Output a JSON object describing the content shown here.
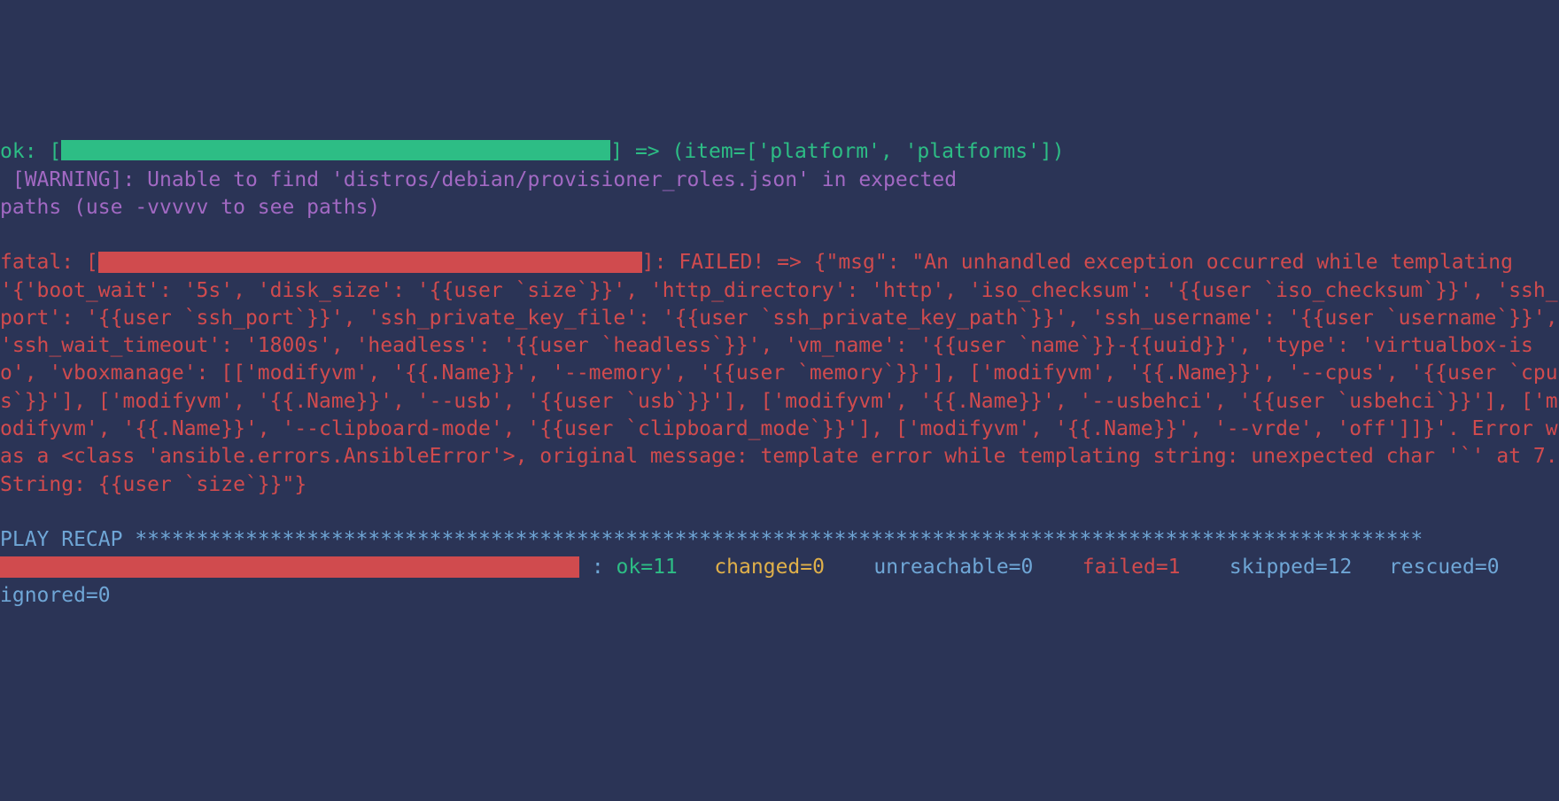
{
  "ok_line": {
    "prefix": "ok: [",
    "suffix": "] => (item=['platform', 'platforms'])"
  },
  "warning_line": " [WARNING]: Unable to find 'distros/debian/provisioner_roles.json' in expected\npaths (use -vvvvv to see paths)",
  "fatal": {
    "prefix": "fatal: [",
    "msg": "]: FAILED! => {\"msg\": \"An unhandled exception occurred while templating '{'boot_wait': '5s', 'disk_size': '{{user `size`}}', 'http_directory': 'http', 'iso_checksum': '{{user `iso_checksum`}}', 'ssh_port': '{{user `ssh_port`}}', 'ssh_private_key_file': '{{user `ssh_private_key_path`}}', 'ssh_username': '{{user `username`}}', 'ssh_wait_timeout': '1800s', 'headless': '{{user `headless`}}', 'vm_name': '{{user `name`}}-{{uuid}}', 'type': 'virtualbox-iso', 'vboxmanage': [['modifyvm', '{{.Name}}', '--memory', '{{user `memory`}}'], ['modifyvm', '{{.Name}}', '--cpus', '{{user `cpus`}}'], ['modifyvm', '{{.Name}}', '--usb', '{{user `usb`}}'], ['modifyvm', '{{.Name}}', '--usbehci', '{{user `usbehci`}}'], ['modifyvm', '{{.Name}}', '--clipboard-mode', '{{user `clipboard_mode`}}'], ['modifyvm', '{{.Name}}', '--vrde', 'off']]}'. Error was a <class 'ansible.errors.AnsibleError'>, original message: template error while templating string: unexpected char '`' at 7. String: {{user `size`}}\"}"
  },
  "recap": {
    "label": "PLAY RECAP ",
    "stars": "*********************************************************************************************************",
    "colon": " : ",
    "ok": "ok=11   ",
    "changed": "changed=0    ",
    "unreachable": "unreachable=0    ",
    "failed": "failed=1    ",
    "skipped": "skipped=12   ",
    "rescued": "rescued=0    ",
    "ignored": "ignored=0"
  }
}
